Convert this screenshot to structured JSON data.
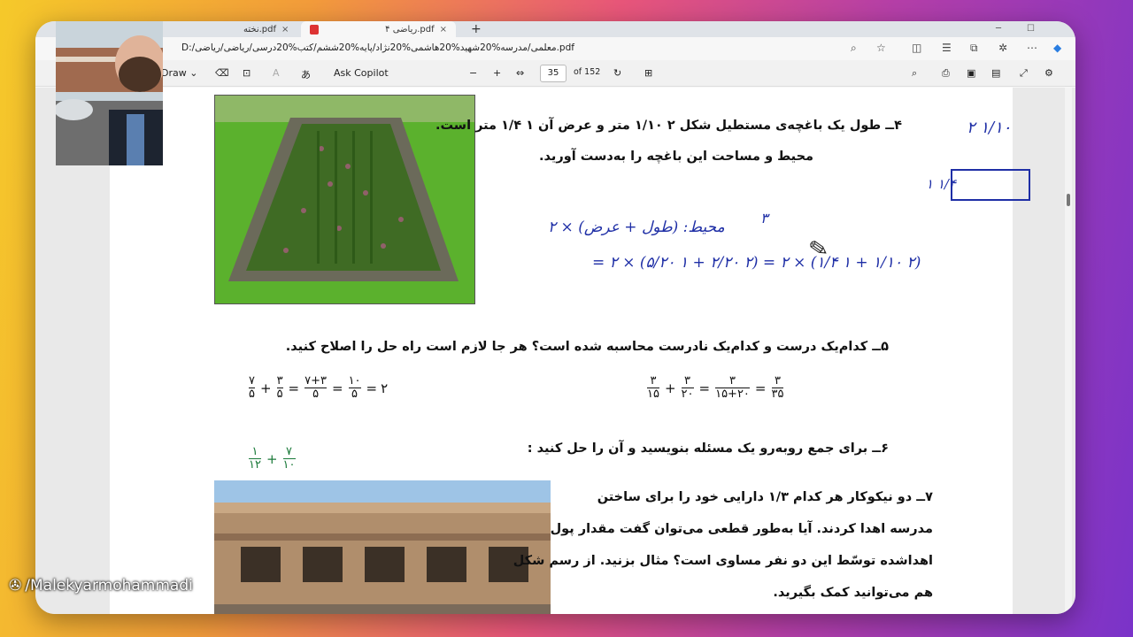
{
  "browser": {
    "tabs": [
      {
        "label": "نخته.pdf",
        "close": "×"
      },
      {
        "label": "ریاضی ۴.pdf",
        "close": "×"
      }
    ],
    "new_tab": "+",
    "url": "D:/معلمی/مدرسه%20شهید%20هاشمی%20نژاد/پایه%20ششم/کتب%20درسی/ریاضی/ریاضی.pdf"
  },
  "pdf_toolbar": {
    "draw_label": "Draw",
    "ask_copilot": "Ask Copilot",
    "page_current": "35",
    "page_total": "of 152",
    "zoom_out": "−",
    "zoom_in": "+"
  },
  "questions": {
    "q4": {
      "line1": "۴ــ طول یک باغچه‌ی مستطیل شکل ۲ ۱/۱۰ متر و عرض آن ۱ ۱/۴ متر است.",
      "line2": "محیط و مساحت این باغچه را به‌دست آورید."
    },
    "q5": {
      "text": "۵ــ کدام‌یک درست و کدام‌یک نادرست محاسبه شده است؟ هر جا لازم است راه حل را اصلاح کنید.",
      "eq_left": [
        "۷/۵",
        "+",
        "۳/۵",
        "=",
        "۷+۳/۵",
        "=",
        "۱۰/۵",
        "=",
        "۲"
      ],
      "eq_right": [
        "۳/۱۵",
        "+",
        "۳/۲۰",
        "=",
        "۳/۱۵+۲۰",
        "=",
        "۳/۳۵"
      ]
    },
    "q6": {
      "text": "۶ــ برای جمع روبه‌رو یک مسئله بنویسید و آن را حل کنید :",
      "frac_a_num": "۱",
      "frac_a_den": "۱۲",
      "frac_b_num": "۷",
      "frac_b_den": "۱۰"
    },
    "q7": {
      "line1": "۷ــ دو نیکوکار هر کدام ۱/۳ دارایی خود را برای ساختن",
      "line2": "مدرسه اهدا کردند. آیا به‌طور قطعی می‌توان گفت مقدار پول",
      "line3": "اهداشده توسّط این دو نفر مساوی است؟ مثال بزنید. از رسم شکل",
      "line4": "هم می‌توانید کمک بگیرید."
    }
  },
  "handwriting": {
    "perimeter_formula": "محیط: (طول + عرض) × ۲",
    "calc_line": "(۲ ۱/۱۰ + ۱ ۱/۴) × ۲ = (۲ ۲/۲۰ + ۱ ۵/۲۰) × ۲ =",
    "rect_top": "۲ ۱/۱۰",
    "rect_side": "۱ ۱/۴",
    "three": "۳"
  },
  "watermark": "/Malekyarmohammadi",
  "colors": {
    "ink": "#1f2fa6",
    "green_frac": "#1b7a3a",
    "bg_gradient_start": "#f5c92a",
    "bg_gradient_end": "#7a33c9"
  }
}
